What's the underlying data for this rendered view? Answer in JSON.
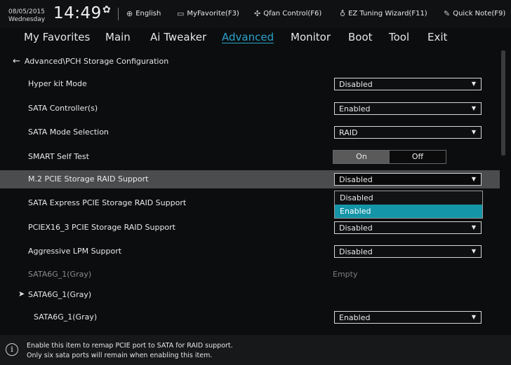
{
  "header": {
    "date": "08/05/2015",
    "weekday": "Wednesday",
    "time": "14:49",
    "tools": [
      {
        "icon": "globe-icon",
        "label": "English"
      },
      {
        "icon": "monitor-icon",
        "label": "MyFavorite(F3)"
      },
      {
        "icon": "fan-icon",
        "label": "Qfan Control(F6)"
      },
      {
        "icon": "bulb-icon",
        "label": "EZ Tuning Wizard(F11)"
      },
      {
        "icon": "note-icon",
        "label": "Quick Note(F9)"
      }
    ]
  },
  "tabs": [
    "My Favorites",
    "Main",
    "Ai Tweaker",
    "Advanced",
    "Monitor",
    "Boot",
    "Tool",
    "Exit"
  ],
  "active_tab": "Advanced",
  "breadcrumb": "Advanced\\PCH Storage Configuration",
  "settings": [
    {
      "label": "Hyper kit Mode",
      "value": "Disabled"
    },
    {
      "label": "SATA Controller(s)",
      "value": "Enabled"
    },
    {
      "label": "SATA Mode Selection",
      "value": "RAID"
    },
    {
      "label": "SMART Self Test",
      "on": "On",
      "off": "Off"
    },
    {
      "label": "M.2 PCIE Storage RAID Support",
      "value": "Disabled"
    },
    {
      "label": "SATA Express PCIE Storage RAID Support"
    },
    {
      "label": "PCIEX16_3 PCIE Storage RAID Support",
      "value": "Disabled"
    },
    {
      "label": "Aggressive LPM Support",
      "value": "Disabled"
    },
    {
      "label": "SATA6G_1(Gray)",
      "value": "Empty"
    },
    {
      "label": "SATA6G_1(Gray)"
    },
    {
      "label": "SATA6G_1(Gray)",
      "value": "Enabled"
    }
  ],
  "dropdown": {
    "options": [
      "Disabled",
      "Enabled"
    ],
    "highlighted": "Enabled"
  },
  "help": {
    "line1": "Enable this item to remap PCIE port to SATA for RAID support.",
    "line2": "Only six sata ports will remain when enabling this item."
  },
  "colors": {
    "accent": "#2aa4c9",
    "highlight_row": "#4b4c4e",
    "dropdown_selected": "#1595a8"
  }
}
